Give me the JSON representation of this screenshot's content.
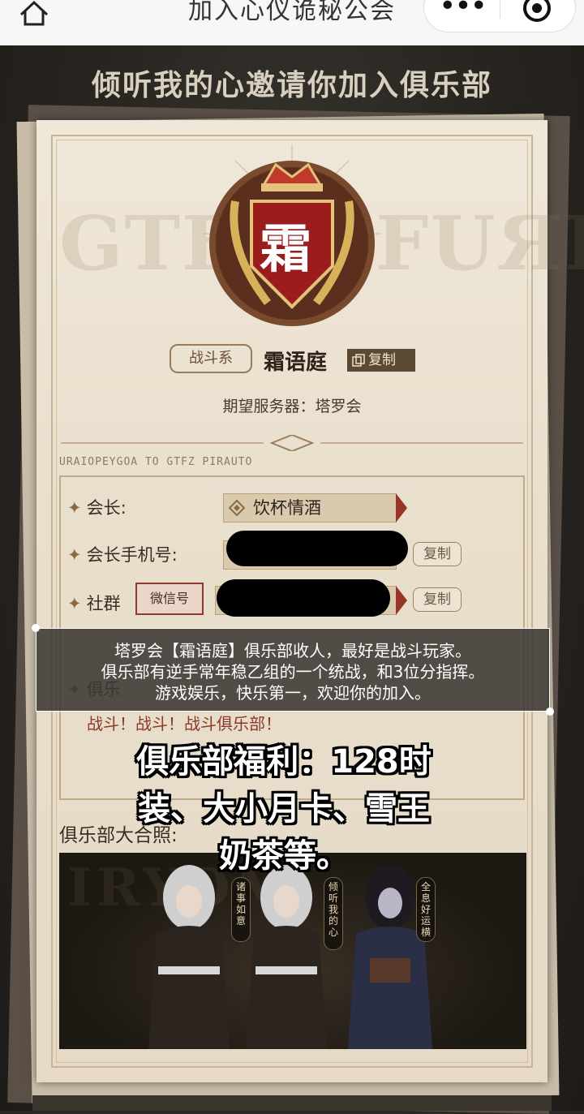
{
  "nav": {
    "title": "加入心仪诡秘公会",
    "more_label": "•••"
  },
  "headline": "倾听我的心邀请你加入俱乐部",
  "club": {
    "emblem_char": "霜",
    "type_tag": "战斗系",
    "name": "霜语庭",
    "copy_label": "复制",
    "server_line": "期望服务器：塔罗会"
  },
  "decor": {
    "watermark_left": "GTFZ",
    "watermark_right": "FUЯH",
    "rune_line": "URAIOPEYGOA TO GTFZ PIRAUTO"
  },
  "info": {
    "leader_label": "会长:",
    "leader_value": "饮杯情酒",
    "phone_label": "会长手机号:",
    "community_label": "社群",
    "wechat_tag": "微信号",
    "copy_label": "复制",
    "hidden_label": "俱乐"
  },
  "slogan": "战斗！战斗！战斗俱乐部！",
  "photo": {
    "title": "俱乐部大合照:",
    "tags": [
      "诸事如意",
      "倾听我的心",
      "全息好运横"
    ]
  },
  "overlay": {
    "caption_lines": [
      "塔罗会【霜语庭】俱乐部收人，最好是战斗玩家。",
      "俱乐部有逆手常年稳乙组的一个统战，和3位分指挥。",
      "游戏娱乐，快乐第一，欢迎你的加入。"
    ],
    "big_lines": [
      "俱乐部福利：128时",
      "装、大小月卡、雪王",
      "奶茶等。"
    ]
  }
}
